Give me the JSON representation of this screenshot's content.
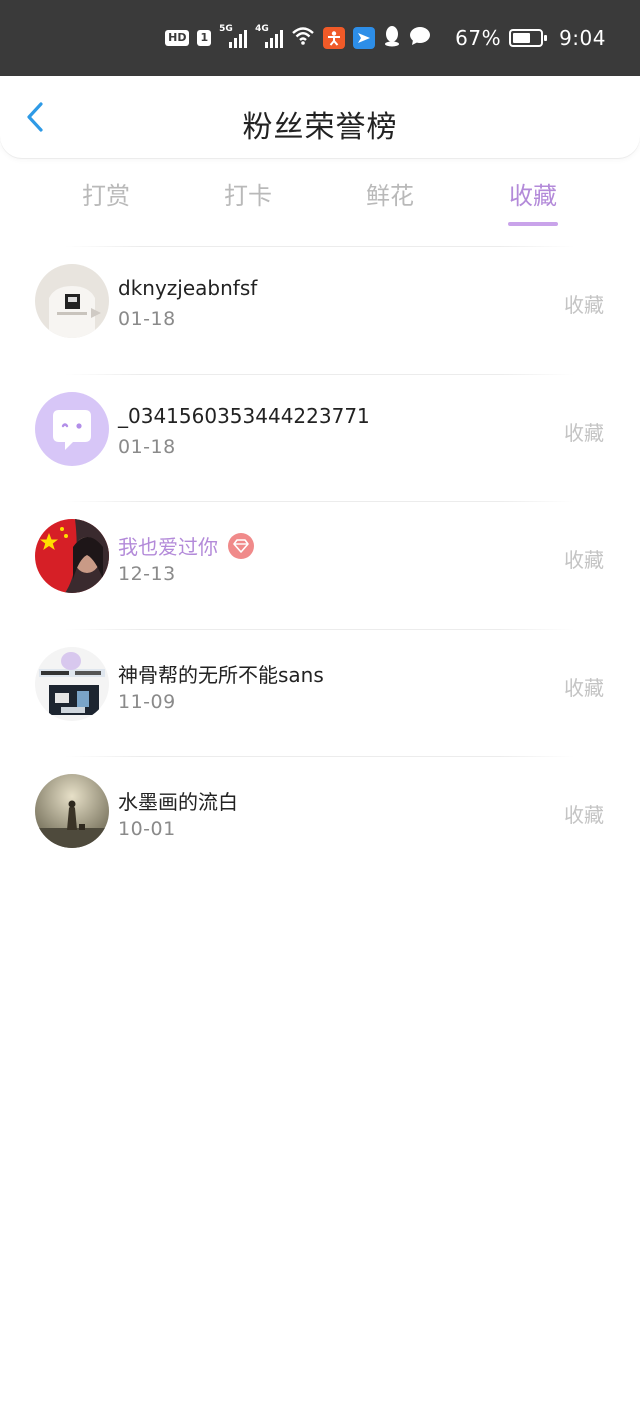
{
  "status_bar": {
    "hd_label": "HD",
    "sim1_label": "1",
    "sig1_gen": "5G",
    "sig2_gen": "4G",
    "battery_text": "67%",
    "battery_level": 0.67,
    "time": "9:04",
    "icons": [
      "wifi-icon",
      "app-orange-icon",
      "app-blue-icon",
      "qq-icon",
      "chat-bubble-icon",
      "leaf-icon"
    ]
  },
  "header": {
    "title": "粉丝荣誉榜"
  },
  "tabs": [
    {
      "label": "打赏",
      "active": false
    },
    {
      "label": "打卡",
      "active": false
    },
    {
      "label": "鲜花",
      "active": false
    },
    {
      "label": "收藏",
      "active": true
    }
  ],
  "fans": [
    {
      "name": "dknyzjeabnfsf",
      "date": "01-18",
      "action": "收藏",
      "vip": false
    },
    {
      "name": "_0341560353444223771",
      "date": "01-18",
      "action": "收藏",
      "vip": false
    },
    {
      "name": "我也爱过你",
      "date": "12-13",
      "action": "收藏",
      "vip": true
    },
    {
      "name": "神骨帮的无所不能sans",
      "date": "11-09",
      "action": "收藏",
      "vip": false
    },
    {
      "name": "水墨画的流白",
      "date": "10-01",
      "action": "收藏",
      "vip": false
    }
  ],
  "colors": {
    "accent": "#b38ad9",
    "back_arrow": "#2e9ae6",
    "status_bar_bg": "#3a3a3a"
  }
}
